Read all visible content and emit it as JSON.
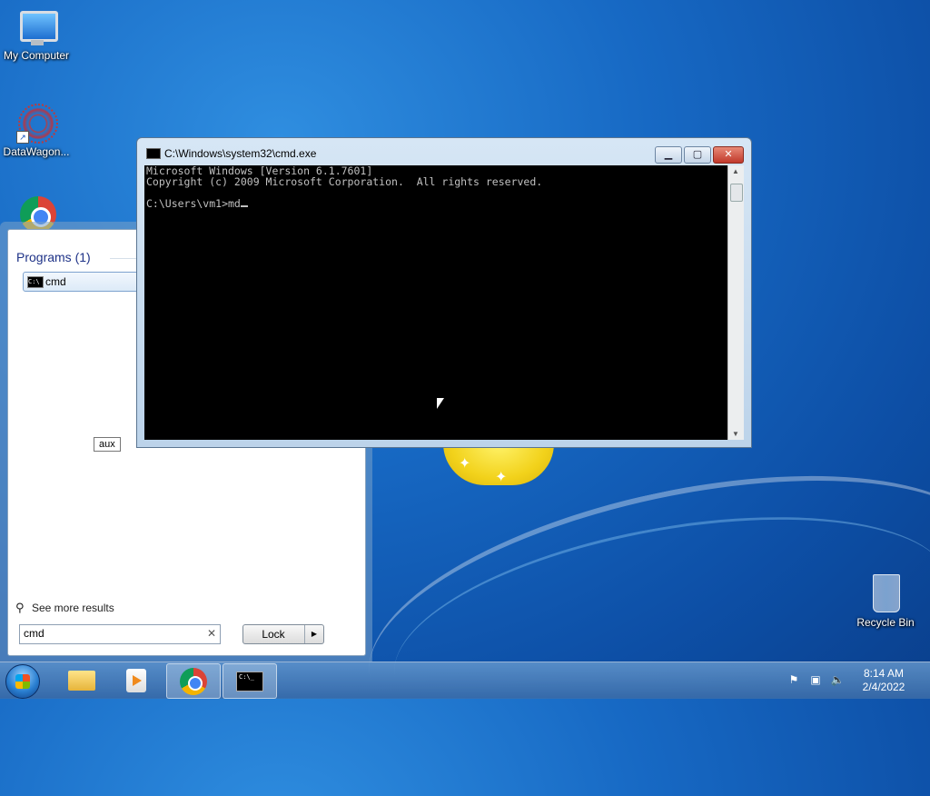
{
  "desktop": {
    "icons": [
      {
        "label": "My Computer"
      },
      {
        "label": "DataWagon..."
      },
      {
        "label": "Recycle Bin"
      }
    ]
  },
  "start_menu": {
    "programs_header": "Programs (1)",
    "programs": [
      {
        "label": "cmd",
        "icon": "cmd-icon"
      }
    ],
    "tooltip": "aux",
    "see_more": "See more results",
    "search_value": "cmd",
    "clear_glyph": "✕",
    "lock_label": "Lock",
    "lock_arrow": "▶"
  },
  "cmd_window": {
    "title": "C:\\Windows\\system32\\cmd.exe",
    "console_lines": [
      "Microsoft Windows [Version 6.1.7601]",
      "Copyright (c) 2009 Microsoft Corporation.  All rights reserved.",
      "",
      "C:\\Users\\vm1>md"
    ],
    "min_glyph": "▁",
    "max_glyph": "▢",
    "close_glyph": "✕"
  },
  "taskbar": {
    "clock_time": "8:14 AM",
    "clock_date": "2/4/2022",
    "cmd_glyph": "C:\\_"
  },
  "colors": {
    "desktop_blue": "#1769c4",
    "console_bg": "#000000",
    "console_fg": "#c0c0c0",
    "close_red": "#c0392b"
  }
}
